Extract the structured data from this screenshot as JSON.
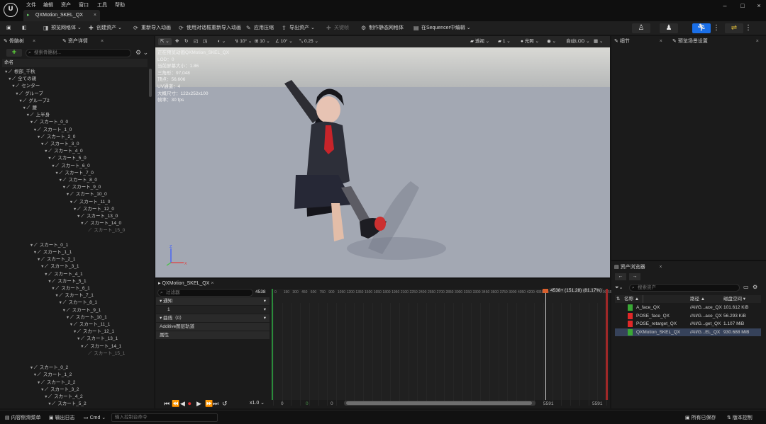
{
  "menu": [
    "文件",
    "编辑",
    "资产",
    "窗口",
    "工具",
    "帮助"
  ],
  "document_tab": "QXMotion_SKEL_QX",
  "toolbar": {
    "preview_mesh": "预览网格体",
    "create_asset": "创建资产",
    "reimport": "重新导入动画",
    "reimport_dialog": "使用对话框重新导入动画",
    "apply_compression": "应用压缩",
    "export_asset": "导出资产",
    "keyframe": "关键帧",
    "make_static": "制作静态网格体",
    "edit_in_sequencer": "在Sequencer中编辑"
  },
  "left_tabs": {
    "skeleton_tree": "骨骼树",
    "asset_details": "资产详情"
  },
  "skeleton": {
    "search_placeholder": "搜索骨骼树...",
    "column_name": "命名",
    "bones": [
      {
        "name": "根部_千秋",
        "d": 0
      },
      {
        "name": "全ての親",
        "d": 1
      },
      {
        "name": "センター",
        "d": 2
      },
      {
        "name": "グルーブ",
        "d": 3
      },
      {
        "name": "グルーブ2",
        "d": 4
      },
      {
        "name": "腰",
        "d": 5
      },
      {
        "name": "上半身",
        "d": 6
      },
      {
        "name": "スカート_0_0",
        "d": 7
      },
      {
        "name": "スカート_1_0",
        "d": 8
      },
      {
        "name": "スカート_2_0",
        "d": 9
      },
      {
        "name": "スカート_3_0",
        "d": 10
      },
      {
        "name": "スカート_4_0",
        "d": 11
      },
      {
        "name": "スカート_5_0",
        "d": 12
      },
      {
        "name": "スカート_6_0",
        "d": 13
      },
      {
        "name": "スカート_7_0",
        "d": 14
      },
      {
        "name": "スカート_8_0",
        "d": 15
      },
      {
        "name": "スカート_9_0",
        "d": 16
      },
      {
        "name": "スカート_10_0",
        "d": 17
      },
      {
        "name": "スカート_11_0",
        "d": 18
      },
      {
        "name": "スカート_12_0",
        "d": 19
      },
      {
        "name": "スカート_13_0",
        "d": 20
      },
      {
        "name": "スカート_14_0",
        "d": 21
      },
      {
        "name": "スカート_15_0",
        "d": 22,
        "leaf": true
      },
      {
        "name": "",
        "d": 0,
        "gap": true
      },
      {
        "name": "スカート_0_1",
        "d": 7
      },
      {
        "name": "スカート_1_1",
        "d": 8
      },
      {
        "name": "スカート_2_1",
        "d": 9
      },
      {
        "name": "スカート_3_1",
        "d": 10
      },
      {
        "name": "スカート_4_1",
        "d": 11
      },
      {
        "name": "スカート_5_1",
        "d": 12
      },
      {
        "name": "スカート_6_1",
        "d": 13
      },
      {
        "name": "スカート_7_1",
        "d": 14
      },
      {
        "name": "スカート_8_1",
        "d": 15
      },
      {
        "name": "スカート_9_1",
        "d": 16
      },
      {
        "name": "スカート_10_1",
        "d": 17
      },
      {
        "name": "スカート_11_1",
        "d": 18
      },
      {
        "name": "スカート_12_1",
        "d": 19
      },
      {
        "name": "スカート_13_1",
        "d": 20
      },
      {
        "name": "スカート_14_1",
        "d": 21
      },
      {
        "name": "スカート_15_1",
        "d": 22,
        "leaf": true
      },
      {
        "name": "",
        "d": 0,
        "gap": true
      },
      {
        "name": "スカート_0_2",
        "d": 7
      },
      {
        "name": "スカート_1_2",
        "d": 8
      },
      {
        "name": "スカート_2_2",
        "d": 9
      },
      {
        "name": "スカート_3_2",
        "d": 10
      },
      {
        "name": "スカート_4_2",
        "d": 11
      },
      {
        "name": "スカート_5_2",
        "d": 12
      },
      {
        "name": "スカート_6_2",
        "d": 13
      },
      {
        "name": "スカート_7_2",
        "d": 14
      },
      {
        "name": "スカート_8_2",
        "d": 15
      }
    ]
  },
  "viewport": {
    "toolbar": {
      "perspective": "透视",
      "lit": "光照",
      "auto_lod": "自动LOD",
      "snap_angle": "10°",
      "snap_move": "10",
      "snap_rot": "10°",
      "snap_scale": "0.25",
      "cam_speed": "1"
    },
    "stats": [
      "正在预览动画QXMotion_SKEL_QX",
      "LOD：0",
      "当前屏幕大小：1.86",
      "三角形：97,048",
      "顶点：56,606",
      "UV通道：4",
      "大概尺寸：122x252x100",
      "帧率：30 fps"
    ]
  },
  "timeline": {
    "tab": "QXMotion_SKEL_QX",
    "filter_placeholder": "过滤器",
    "frame_count": "4538",
    "playhead": "4538+ (151.28) (81.17%)",
    "tracks": [
      {
        "label": "通知",
        "kind": "header"
      },
      {
        "label": "1",
        "kind": "sub"
      },
      {
        "label": "曲线（0）",
        "kind": "header"
      },
      {
        "label": "Additive图层轨道",
        "kind": "header"
      },
      {
        "label": "属性",
        "kind": "header"
      }
    ],
    "speed": "x1.0",
    "range_start": "0",
    "range_mid": "0",
    "range_begin": "0",
    "range_end": "5591",
    "range_end2": "5591",
    "ticks": [
      "0",
      "150",
      "300",
      "450",
      "600",
      "750",
      "900",
      "1050",
      "1200",
      "1350",
      "1500",
      "1650",
      "1800",
      "1950",
      "2100",
      "2250",
      "2400",
      "2550",
      "2700",
      "2850",
      "3000",
      "3150",
      "3300",
      "3450",
      "3600",
      "3750",
      "3900",
      "4050",
      "4200",
      "4350",
      "4500",
      "4650",
      "4800",
      "4950",
      "5100",
      "5250",
      "5400",
      "5550"
    ]
  },
  "right_tabs": {
    "details": "细节",
    "preview_settings": "预览场景设置"
  },
  "asset_browser": {
    "tab": "资产浏览器",
    "search_placeholder": "搜索资产",
    "col_name": "名称",
    "col_path": "路径",
    "col_size": "磁盘空间",
    "rows": [
      {
        "name": "A_face_QX",
        "path": "/All/G...ace_QX",
        "size": "101.612 KiB",
        "color": "#3aa835",
        "selected": false
      },
      {
        "name": "POSE_face_QX",
        "path": "/All/G...ace_QX",
        "size": "56.293 KiB",
        "color": "#e02828",
        "selected": false
      },
      {
        "name": "POSE_retarget_QX",
        "path": "/All/G...get_QX",
        "size": "1.107 MiB",
        "color": "#e02828",
        "selected": false
      },
      {
        "name": "QXMotion_SKEL_QX",
        "path": "/All/G...EL_QX",
        "size": "930.688 MiB",
        "color": "#3aa835",
        "selected": true
      }
    ]
  },
  "statusbar": {
    "content_drawer": "内容侧滑菜单",
    "output_log": "输出日志",
    "cmd": "Cmd",
    "console_placeholder": "输入控制台命令",
    "save_all": "所有已保存",
    "source_control": "版本控制"
  }
}
